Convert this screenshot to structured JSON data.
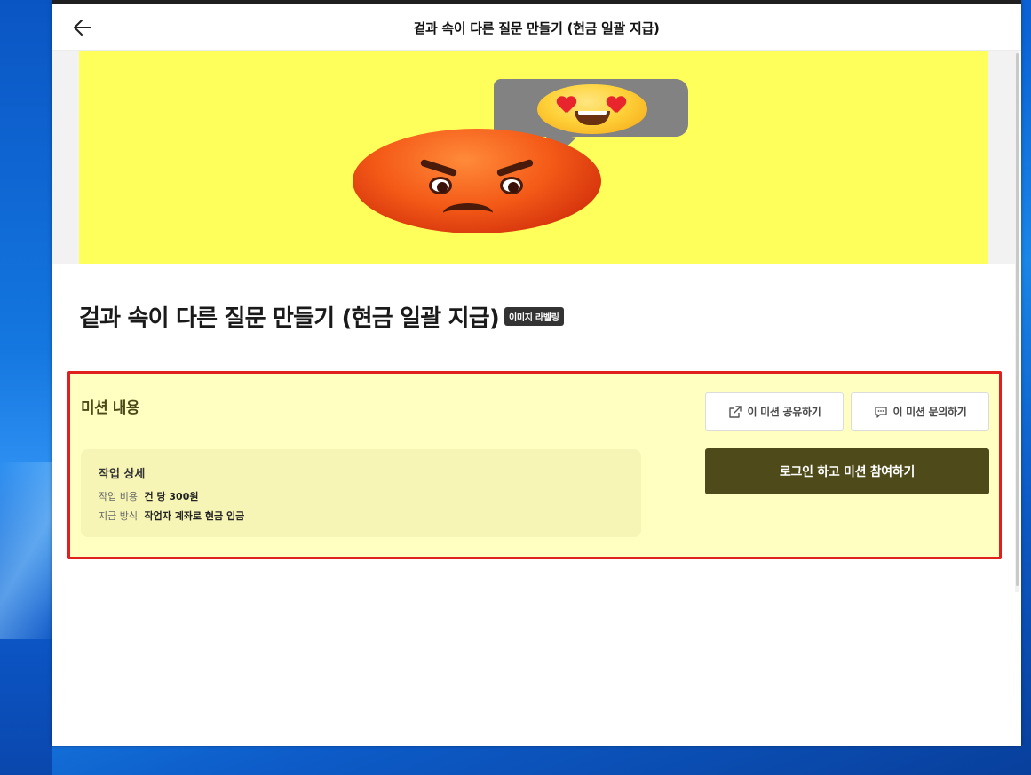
{
  "header": {
    "title": "겉과 속이 다른 질문 만들기 (현금 일괄 지급)",
    "back_icon": "arrow-left-icon"
  },
  "banner": {
    "images": [
      "angry-face-emoji",
      "heart-eyes-emoji",
      "speech-bubble"
    ],
    "background_color": "#ffff5c"
  },
  "page": {
    "title": "겉과 속이 다른 질문 만들기 (현금 일괄 지급)",
    "tag": "이미지 라벨링"
  },
  "mission": {
    "heading": "미션 내용",
    "share_label": "이 미션 공유하기",
    "inquiry_label": "이 미션 문의하기",
    "join_label": "로그인 하고 미션 참여하기",
    "detail": {
      "title": "작업 상세",
      "rows": [
        {
          "label": "작업 비용",
          "value": "건 당 300원"
        },
        {
          "label": "지급 방식",
          "value": "작업자 계좌로 현금 입금"
        }
      ]
    }
  },
  "colors": {
    "highlight_border": "#e0201f",
    "mission_bg": "#ffffc2",
    "primary_button": "#4f4a19"
  }
}
